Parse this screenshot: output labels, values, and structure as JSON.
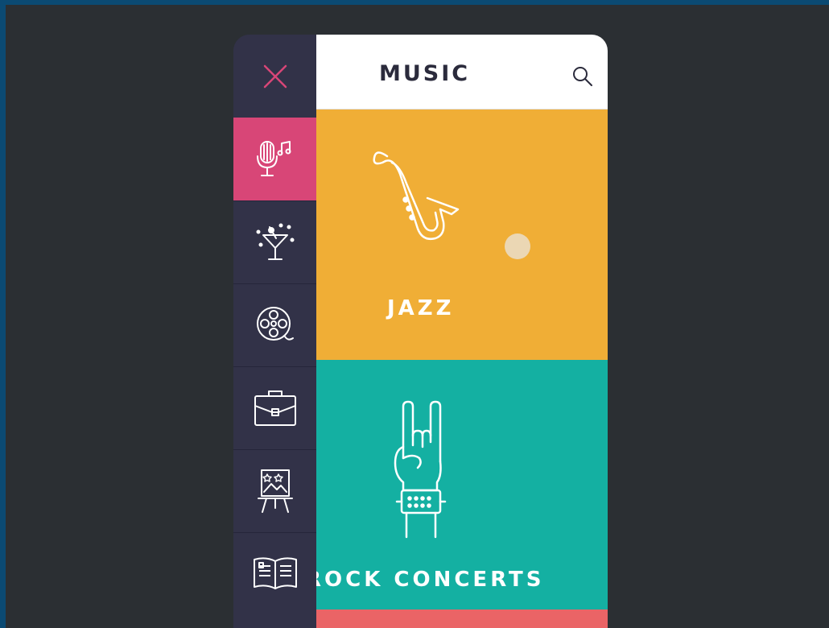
{
  "header": {
    "title": "MUSIC"
  },
  "sidebar": {
    "close_icon": "close-icon",
    "items": [
      {
        "id": "music",
        "icon": "microphone-icon",
        "active": true
      },
      {
        "id": "nightlife",
        "icon": "cocktail-icon",
        "active": false
      },
      {
        "id": "movies",
        "icon": "film-reel-icon",
        "active": false
      },
      {
        "id": "business",
        "icon": "briefcase-icon",
        "active": false
      },
      {
        "id": "art",
        "icon": "easel-icon",
        "active": false
      },
      {
        "id": "books",
        "icon": "book-icon",
        "active": false
      }
    ]
  },
  "cards": [
    {
      "label": "JAZZ",
      "icon": "saxophone-icon",
      "color": "#f0ae36"
    },
    {
      "label": "ROCK CONCERTS",
      "icon": "rock-hand-icon",
      "color": "#14b0a2"
    },
    {
      "label": "",
      "icon": "",
      "color": "#ea6466"
    }
  ],
  "colors": {
    "background": "#2b2f33",
    "sidebar": "#323248",
    "active_item": "#d84677",
    "close_accent": "#d84677",
    "text_dark": "#2b2b3c"
  }
}
